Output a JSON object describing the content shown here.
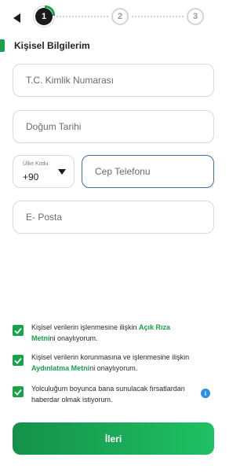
{
  "stepper": {
    "steps": [
      {
        "number": "1",
        "state": "active"
      },
      {
        "number": "2",
        "state": "inactive"
      },
      {
        "number": "3",
        "state": "inactive"
      }
    ],
    "back_icon": "triangle-left-icon"
  },
  "section": {
    "title": "Kişisel Bilgilerim"
  },
  "form": {
    "tc_placeholder": "T.C. Kimlik Numarası",
    "dob_placeholder": "Doğum Tarihi",
    "country_code_label": "Ülke Kodu",
    "country_code_value": "+90",
    "phone_placeholder": "Cep Telefonu",
    "email_placeholder": "E- Posta"
  },
  "consents": [
    {
      "checked": true,
      "before": "Kişisel verilerin işlenmesine ilişkin ",
      "link": "Açık Rıza Metni",
      "after": "ni onaylıyorum."
    },
    {
      "checked": true,
      "before": "Kişisel verilerin korunmasına ve işlenmesine ilişkin ",
      "link": "Aydınlatma Metni",
      "after": "ni onaylıyorum."
    },
    {
      "checked": true,
      "before": "Yolculuğum boyunca bana sunulacak fırsatlardan haberdar olmak istiyorum.",
      "link": "",
      "after": ""
    }
  ],
  "info_icon": "i",
  "next_button": "İleri",
  "colors": {
    "accent": "#16a34a",
    "focus_border": "#3d6fa8",
    "info": "#2b8fe0"
  }
}
